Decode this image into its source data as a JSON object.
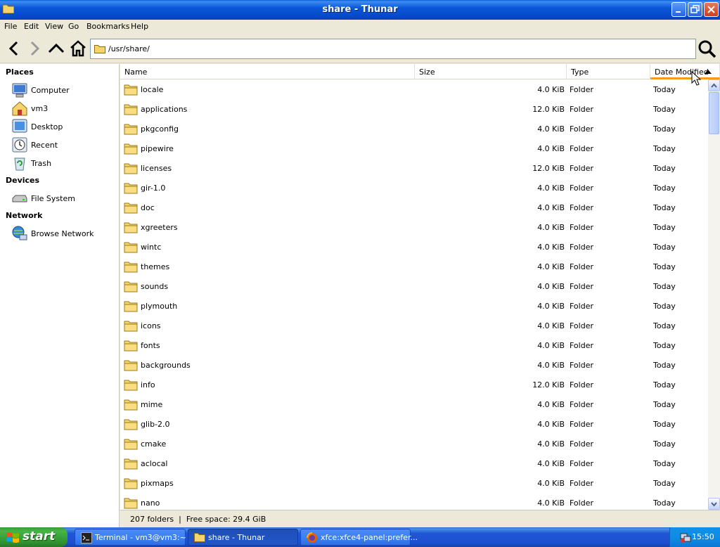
{
  "window": {
    "title": "share - Thunar"
  },
  "menubar": {
    "items": [
      "File",
      "Edit",
      "View",
      "Go",
      "Bookmarks",
      "Help"
    ]
  },
  "location": {
    "path": "/usr/share/"
  },
  "sidebar": {
    "places_heading": "Places",
    "places": [
      {
        "label": "Computer",
        "icon": "computer-icon"
      },
      {
        "label": "vm3",
        "icon": "home-folder-icon"
      },
      {
        "label": "Desktop",
        "icon": "desktop-icon"
      },
      {
        "label": "Recent",
        "icon": "recent-icon"
      },
      {
        "label": "Trash",
        "icon": "trash-icon"
      }
    ],
    "devices_heading": "Devices",
    "devices": [
      {
        "label": "File System",
        "icon": "drive-icon"
      }
    ],
    "network_heading": "Network",
    "network": [
      {
        "label": "Browse Network",
        "icon": "network-icon"
      }
    ]
  },
  "columns": {
    "name": "Name",
    "size": "Size",
    "type": "Type",
    "date": "Date Modified"
  },
  "files": [
    {
      "name": "locale",
      "size": "4.0 KiB",
      "type": "Folder",
      "date": "Today"
    },
    {
      "name": "applications",
      "size": "12.0 KiB",
      "type": "Folder",
      "date": "Today"
    },
    {
      "name": "pkgconfig",
      "size": "4.0 KiB",
      "type": "Folder",
      "date": "Today"
    },
    {
      "name": "pipewire",
      "size": "4.0 KiB",
      "type": "Folder",
      "date": "Today"
    },
    {
      "name": "licenses",
      "size": "12.0 KiB",
      "type": "Folder",
      "date": "Today"
    },
    {
      "name": "gir-1.0",
      "size": "4.0 KiB",
      "type": "Folder",
      "date": "Today"
    },
    {
      "name": "doc",
      "size": "4.0 KiB",
      "type": "Folder",
      "date": "Today"
    },
    {
      "name": "xgreeters",
      "size": "4.0 KiB",
      "type": "Folder",
      "date": "Today"
    },
    {
      "name": "wintc",
      "size": "4.0 KiB",
      "type": "Folder",
      "date": "Today"
    },
    {
      "name": "themes",
      "size": "4.0 KiB",
      "type": "Folder",
      "date": "Today"
    },
    {
      "name": "sounds",
      "size": "4.0 KiB",
      "type": "Folder",
      "date": "Today"
    },
    {
      "name": "plymouth",
      "size": "4.0 KiB",
      "type": "Folder",
      "date": "Today"
    },
    {
      "name": "icons",
      "size": "4.0 KiB",
      "type": "Folder",
      "date": "Today"
    },
    {
      "name": "fonts",
      "size": "4.0 KiB",
      "type": "Folder",
      "date": "Today"
    },
    {
      "name": "backgrounds",
      "size": "4.0 KiB",
      "type": "Folder",
      "date": "Today"
    },
    {
      "name": "info",
      "size": "12.0 KiB",
      "type": "Folder",
      "date": "Today"
    },
    {
      "name": "mime",
      "size": "4.0 KiB",
      "type": "Folder",
      "date": "Today"
    },
    {
      "name": "glib-2.0",
      "size": "4.0 KiB",
      "type": "Folder",
      "date": "Today"
    },
    {
      "name": "cmake",
      "size": "4.0 KiB",
      "type": "Folder",
      "date": "Today"
    },
    {
      "name": "aclocal",
      "size": "4.0 KiB",
      "type": "Folder",
      "date": "Today"
    },
    {
      "name": "pixmaps",
      "size": "4.0 KiB",
      "type": "Folder",
      "date": "Today"
    },
    {
      "name": "nano",
      "size": "4.0 KiB",
      "type": "Folder",
      "date": "Today"
    }
  ],
  "status": {
    "text": "207 folders  |  Free space: 29.4 GiB"
  },
  "taskbar": {
    "start_label": "start",
    "tasks": [
      {
        "label": "Terminal - vm3@vm3:~",
        "icon": "terminal-icon",
        "active": false
      },
      {
        "label": "share - Thunar",
        "icon": "folder-icon",
        "active": true
      },
      {
        "label": "xfce:xfce4-panel:prefer...",
        "icon": "firefox-icon",
        "active": false
      }
    ],
    "clock": "15:50"
  },
  "colors": {
    "titlebar": "#0a57d8",
    "taskbar": "#245edb",
    "start": "#3c9b3c",
    "folder": "#f5d56b",
    "sort_indicator": "#f49c1e"
  }
}
